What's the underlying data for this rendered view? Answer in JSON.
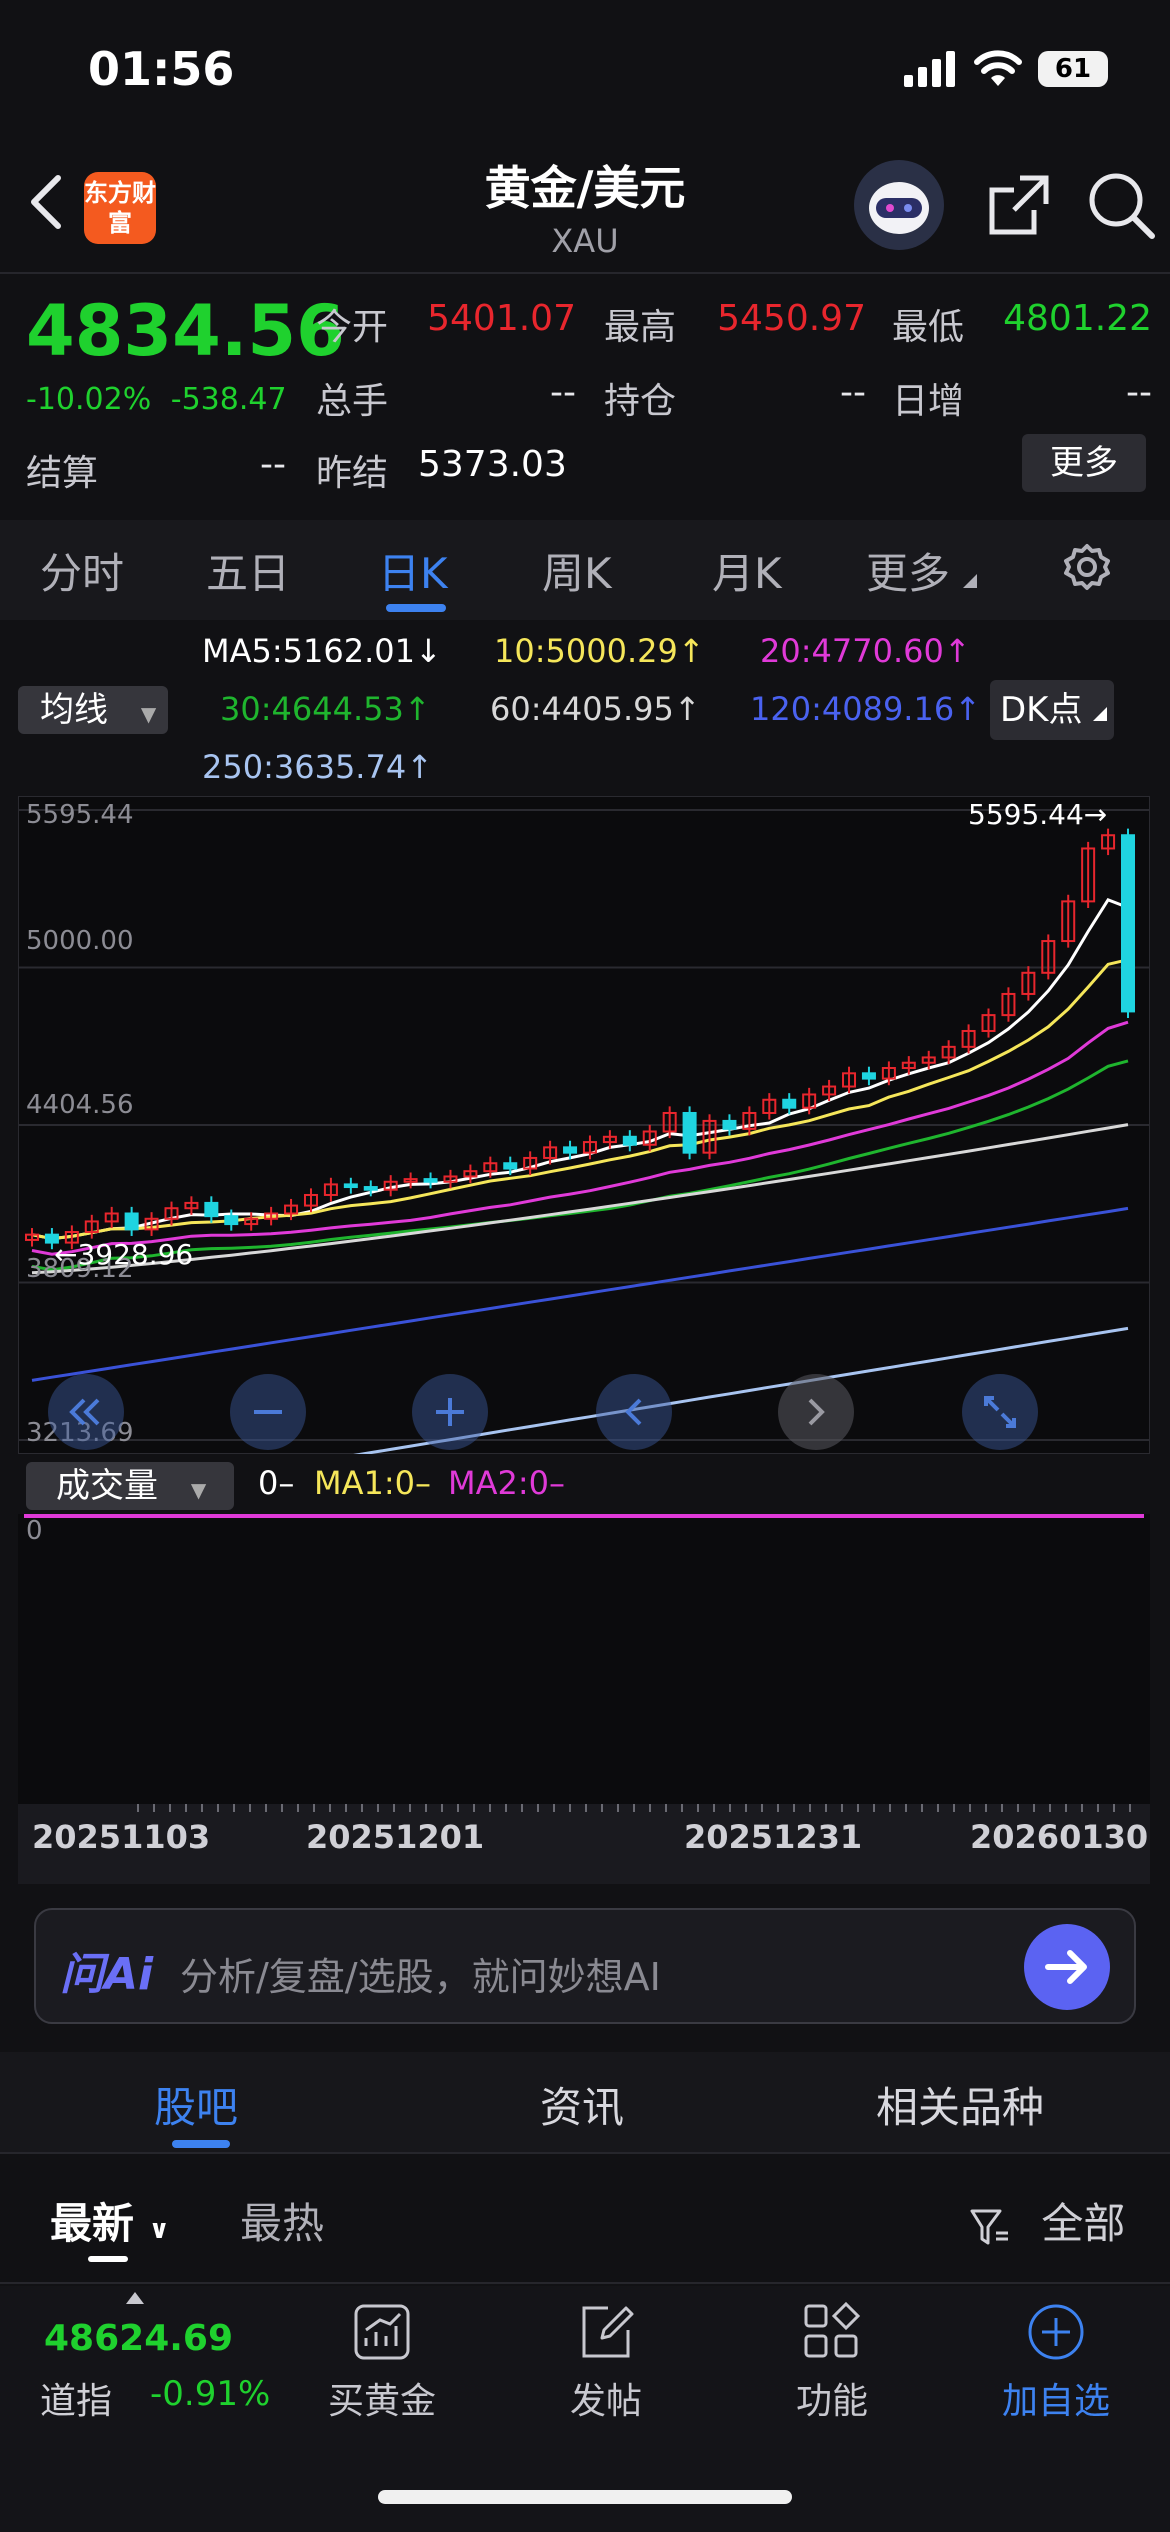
{
  "status_bar": {
    "time": "01:56",
    "battery": "61"
  },
  "nav": {
    "title": "黄金/美元",
    "subtitle": "XAU",
    "logo_text": "东方财富"
  },
  "quote": {
    "price": "4834.56",
    "change_pct": "-10.02%",
    "change_abs": "-538.47",
    "open_label": "今开",
    "open_value": "5401.07",
    "high_label": "最高",
    "high_value": "5450.97",
    "low_label": "最低",
    "low_value": "4801.22",
    "volume_label": "总手",
    "volume_value": "--",
    "oi_label": "持仓",
    "oi_value": "--",
    "daily_inc_label": "日增",
    "daily_inc_value": "--",
    "settle_label": "结算",
    "settle_value": "--",
    "prev_settle_label": "昨结",
    "prev_settle_value": "5373.03",
    "more_label": "更多"
  },
  "period_tabs": [
    "分时",
    "五日",
    "日K",
    "周K",
    "月K",
    "更多"
  ],
  "active_period": "日K",
  "ma_legend": {
    "selector": "均线",
    "ma5": "MA5:5162.01↓",
    "ma10": "10:5000.29↑",
    "ma20": "20:4770.60↑",
    "ma30": "30:4644.53↑",
    "ma60": "60:4405.95↑",
    "ma120": "120:4089.16↑",
    "ma250": "250:3635.74↑",
    "dk_button": "DK点"
  },
  "colors": {
    "up": "#e8262d",
    "down": "#1fd4e0",
    "accent": "#3d82f0",
    "ma5": "#ffffff",
    "ma10": "#f5e65a",
    "ma20": "#e03ad8",
    "ma30": "#1fb52e",
    "ma60": "#d8d8d8",
    "ma120": "#3a52d8",
    "ma250": "#a8c4f0"
  },
  "chart_data": {
    "type": "candlestick",
    "y_axis_labels": [
      "5595.44",
      "5000.00",
      "4404.56",
      "3809.12",
      "3213.69"
    ],
    "ylim": [
      3213.69,
      5595.44
    ],
    "max_marker": "5595.44→",
    "min_marker": "←3928.96",
    "date_labels": [
      "20251103",
      "20251201",
      "20251231",
      "20260130"
    ],
    "approx_closes_first_to_last": [
      3990,
      3960,
      4000,
      4040,
      4070,
      4010,
      4050,
      4090,
      4110,
      4060,
      4030,
      4050,
      4070,
      4100,
      4140,
      4180,
      4170,
      4160,
      4190,
      4200,
      4190,
      4210,
      4230,
      4260,
      4240,
      4280,
      4320,
      4300,
      4340,
      4360,
      4330,
      4380,
      4450,
      4300,
      4420,
      4390,
      4450,
      4500,
      4470,
      4520,
      4550,
      4600,
      4580,
      4620,
      4640,
      4660,
      4700,
      4760,
      4820,
      4900,
      4980,
      5100,
      5250,
      5450,
      5500,
      4834
    ]
  },
  "volume": {
    "selector": "成交量",
    "value": "0–",
    "ma1": "MA1:0–",
    "ma2": "MA2:0–",
    "axis_zero": "0"
  },
  "ai_bar": {
    "logo": "问Ai",
    "placeholder": "分析/复盘/选股，就问妙想AI"
  },
  "content_tabs": [
    "股吧",
    "资讯",
    "相关品种"
  ],
  "sort": {
    "latest": "最新",
    "hottest": "最热",
    "filter": "全部"
  },
  "bottom_bar": {
    "index_value": "48624.69",
    "index_name": "道指",
    "index_change": "-0.91%",
    "buy_gold": "买黄金",
    "post": "发帖",
    "functions": "功能",
    "add_watch": "加自选"
  }
}
